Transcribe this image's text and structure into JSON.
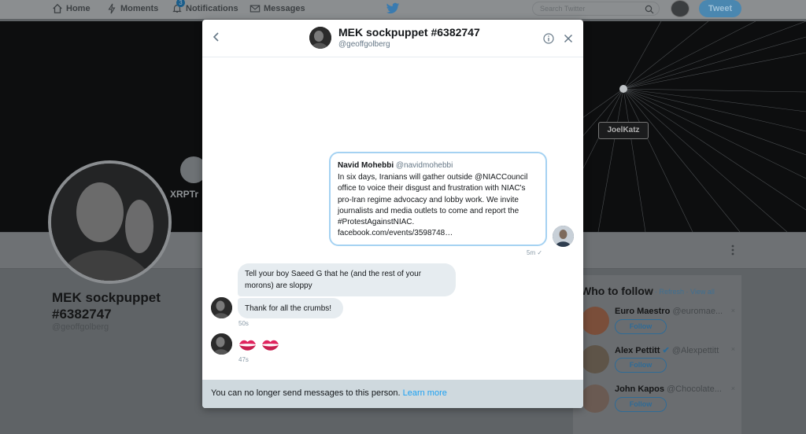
{
  "nav": {
    "home": "Home",
    "moments": "Moments",
    "notifications": "Notifications",
    "notifications_count": "3",
    "messages": "Messages",
    "search_placeholder": "Search Twitter",
    "tweet_button": "Tweet"
  },
  "banner": {
    "joelkatz": "JoelKatz",
    "xrp_text": "XRPTr"
  },
  "profile": {
    "name": "MEK sockpuppet #6382747",
    "handle": "@geoffgolberg"
  },
  "who_to_follow": {
    "title": "Who to follow",
    "links": "· Refresh · View all",
    "follow_label": "Follow",
    "items": [
      {
        "name": "Euro Maestro",
        "handle": "@euromae..."
      },
      {
        "name": "Alex Pettitt",
        "handle": "@Alexpettitt"
      },
      {
        "name": "John Kapos",
        "handle": "@Chocolate..."
      }
    ]
  },
  "dm": {
    "header_name": "MEK sockpuppet #6382747",
    "header_handle": "@geoffgolberg",
    "shared_tweet": {
      "author": "Navid Mohebbi",
      "handle": "@navidmohebbi",
      "text": "In six days, Iranians will gather outside @NIAC­Council office to voice their disgust and frustration with NIAC's pro-Iran regime advocacy and lobby work. We invite journalists and media outlets to come and report the #ProtestAgainstNIAC.",
      "link": "facebook.com/events/3598748…"
    },
    "sent_time": "5m ✓",
    "messages": [
      {
        "text": "Tell your boy Saeed G that he (and the rest of your morons) are sloppy"
      },
      {
        "text": "Thank for all the crumbs!"
      }
    ],
    "time_1": "50s",
    "time_2": "47s",
    "footer_text": "You can no longer send messages to this person.",
    "footer_link": "Learn more"
  },
  "icons": {
    "back": "chevron-left-icon",
    "info": "info-icon",
    "close": "close-icon",
    "kiss": "kiss-mark-icon"
  },
  "colors": {
    "link": "#1da1f2",
    "tweet_border": "#a5d2f2",
    "bubble": "#e6ecf0",
    "footer": "#cfd9de"
  }
}
